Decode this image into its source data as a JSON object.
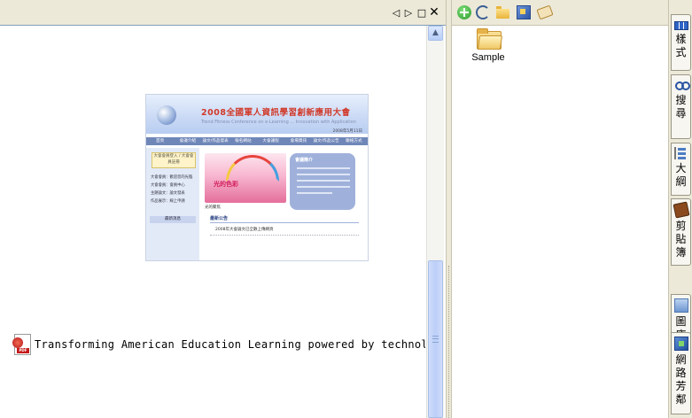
{
  "doc_toolbar": {
    "prev_glyph": "◁",
    "next_glyph": "▷",
    "maximize_glyph": "□",
    "close_glyph": "✕",
    "icons": [
      "triangle-left-icon",
      "triangle-right-icon",
      "maximize-icon",
      "close-icon"
    ]
  },
  "thumbnail": {
    "title": "2008全國軍人資訊學習創新應用大會",
    "subtitle": "Trend Fitness Conference on e-Learning ... Innovation with Application",
    "date_text": "2008年5月11日",
    "nav": [
      "首頁",
      "會議介紹",
      "論文/作品發表",
      "報名網站",
      "大會議程",
      "會場資訊",
      "論文/作品公告",
      "聯絡方式"
    ],
    "login_text": "大會會員登入 / 大會會員註冊",
    "links": [
      "大會會員：歡迎您的光臨",
      "大會會員：會員中心",
      "主題論文：論文發表",
      "作品展示：線上申請"
    ],
    "left_heading": "最新消息",
    "slide_text": "光的色彩",
    "slide_caption": "光的聚焦",
    "aside_title": "會議簡介",
    "news_heading": "最新公告",
    "news_item": "2008年大會論文已全數上傳網頁"
  },
  "document": {
    "pdf_filename": "Transforming American Education Learning powered by technology.pdf",
    "pdf_icon": "pdf-file-icon"
  },
  "scrollbar": {
    "up_glyph": "▲"
  },
  "file_toolbar": {
    "icons": [
      "add-icon",
      "refresh-icon",
      "folder-icon",
      "view-icon",
      "tag-icon"
    ]
  },
  "files": [
    {
      "name": "Sample",
      "icon": "folder-icon"
    }
  ],
  "side_tabs": [
    {
      "label": "樣式",
      "icon": "style-icon"
    },
    {
      "label": "搜尋",
      "icon": "binoculars-icon"
    },
    {
      "label": "大綱",
      "icon": "outline-icon"
    },
    {
      "label": "剪貼簿",
      "icon": "clipboard-icon"
    },
    {
      "label": "圖庫",
      "icon": "gallery-icon"
    },
    {
      "label": "網路芳鄰",
      "icon": "network-icon"
    }
  ]
}
